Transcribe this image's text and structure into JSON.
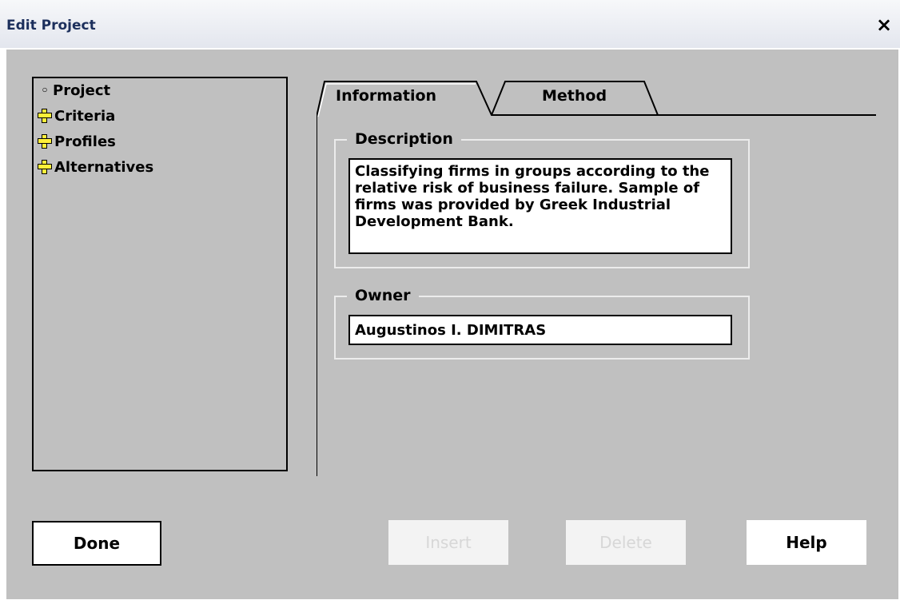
{
  "window": {
    "title": "Edit Project",
    "close_symbol": "×"
  },
  "tree": {
    "items": [
      {
        "label": "Project",
        "icon": "bullet-icon"
      },
      {
        "label": "Criteria",
        "icon": "plus-icon"
      },
      {
        "label": "Profiles",
        "icon": "plus-icon"
      },
      {
        "label": "Alternatives",
        "icon": "plus-icon"
      }
    ]
  },
  "tabs": [
    {
      "label": "Information",
      "active": true
    },
    {
      "label": "Method",
      "active": false
    }
  ],
  "description": {
    "legend": "Description",
    "value": "Classifying firms in groups according to the relative risk of business failure. Sample of firms was provided by Greek Industrial Development Bank."
  },
  "owner": {
    "legend": "Owner",
    "value": "Augustinos I. DIMITRAS"
  },
  "buttons": {
    "done": "Done",
    "insert": "Insert",
    "delete": "Delete",
    "help": "Help"
  },
  "colors": {
    "background": "#c0c0c0",
    "titlebar_text": "#1c2f5c",
    "plus_icon": "#ffef3a",
    "disabled_text": "#d7d7d7"
  }
}
